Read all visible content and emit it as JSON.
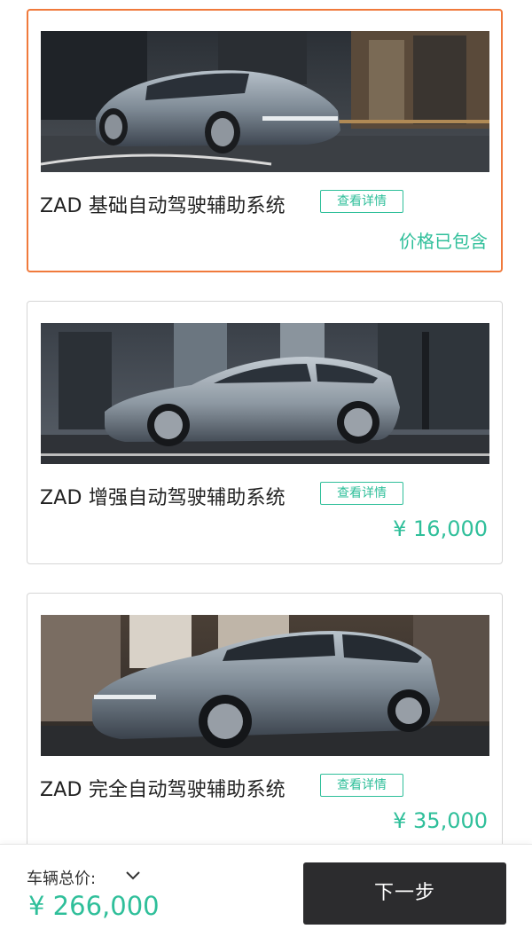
{
  "options": [
    {
      "title": "ZAD 基础自动驾驶辅助系统",
      "detail_label": "查看详情",
      "price": "价格已包含",
      "selected": true,
      "image_icon": "car-photo"
    },
    {
      "title": "ZAD 增强自动驾驶辅助系统",
      "detail_label": "查看详情",
      "price": "¥ 16,000",
      "selected": false,
      "image_icon": "car-photo"
    },
    {
      "title": "ZAD 完全自动驾驶辅助系统",
      "detail_label": "查看详情",
      "price": "¥ 35,000",
      "selected": false,
      "image_icon": "car-photo"
    }
  ],
  "footer": {
    "total_label": "车辆总价:",
    "total_price": "¥ 266,000",
    "next_label": "下一步",
    "expand_icon": "chevron-down-icon"
  },
  "colors": {
    "accent": "#2fbf9a",
    "selected_border": "#f07a3c",
    "button_dark": "#2c2c2e"
  }
}
